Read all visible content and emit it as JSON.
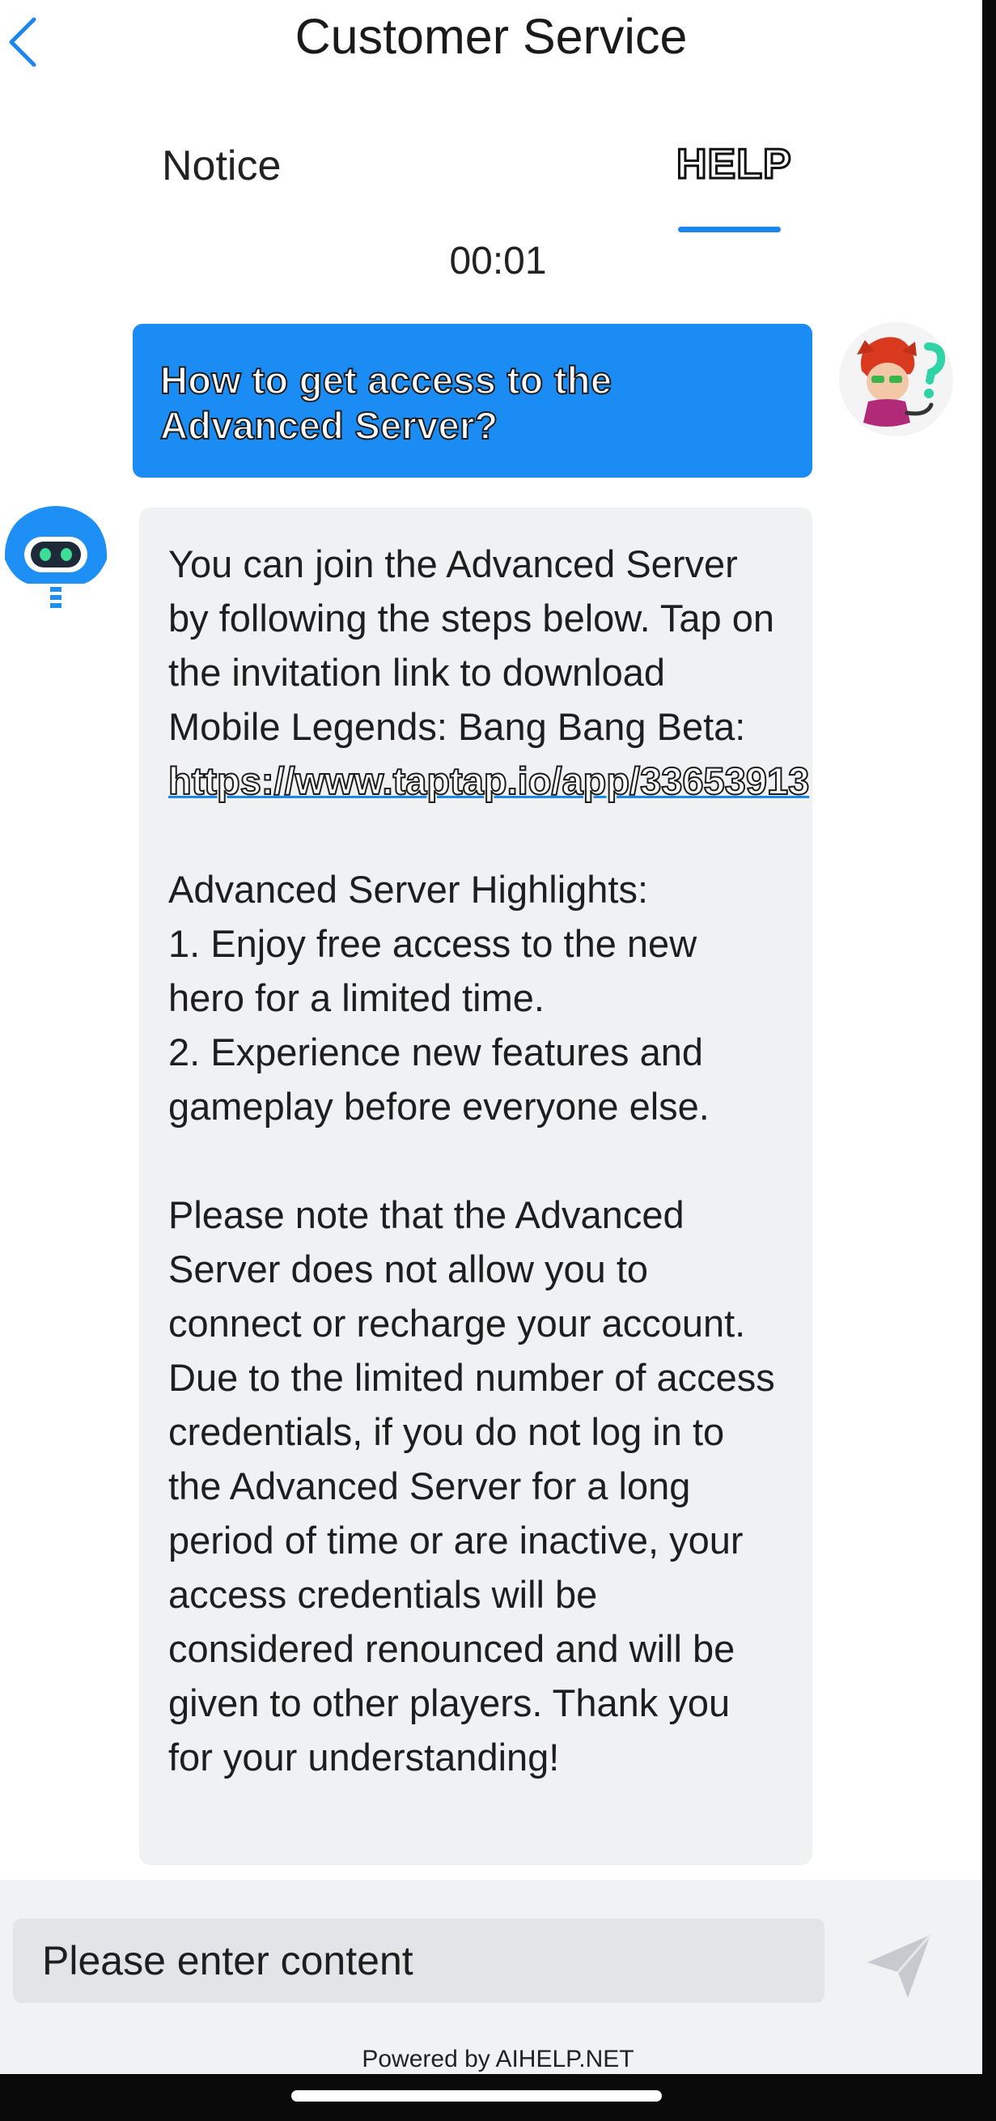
{
  "header": {
    "title": "Customer Service",
    "back_icon": "chevron-left-icon"
  },
  "tabs": {
    "items": [
      {
        "label": "Notice",
        "active": false
      },
      {
        "label": "HELP",
        "active": true
      }
    ],
    "accent": "#1b86ec"
  },
  "chat": {
    "timestamp": "00:01",
    "user_message": "How to get access to the Advanced Server?",
    "user_bubble_color": "#1a8cf3",
    "bot_message": {
      "intro": "You can join the Advanced Server by following the steps below. Tap on the invitation link to download Mobile Legends: Bang Bang Beta: ",
      "link": "https://www.taptap.io/app/33653913",
      "body": "Advanced Server Highlights:\n1. Enjoy free access to the new hero for a limited time.\n2. Experience new features and gameplay before everyone else.\n\nPlease note that the Advanced Server does not allow you to connect or recharge your account. Due to the limited number of access credentials, if you do not log in to the Advanced Server for a long period of time or are inactive, your access credentials will be considered renounced and will be given to other players. Thank you for your understanding!"
    },
    "bot_bubble_color": "#f0f1f3"
  },
  "composer": {
    "placeholder": "Please enter content",
    "send_icon": "send-icon"
  },
  "footer": {
    "powered_by": "Powered by AIHELP.NET"
  }
}
